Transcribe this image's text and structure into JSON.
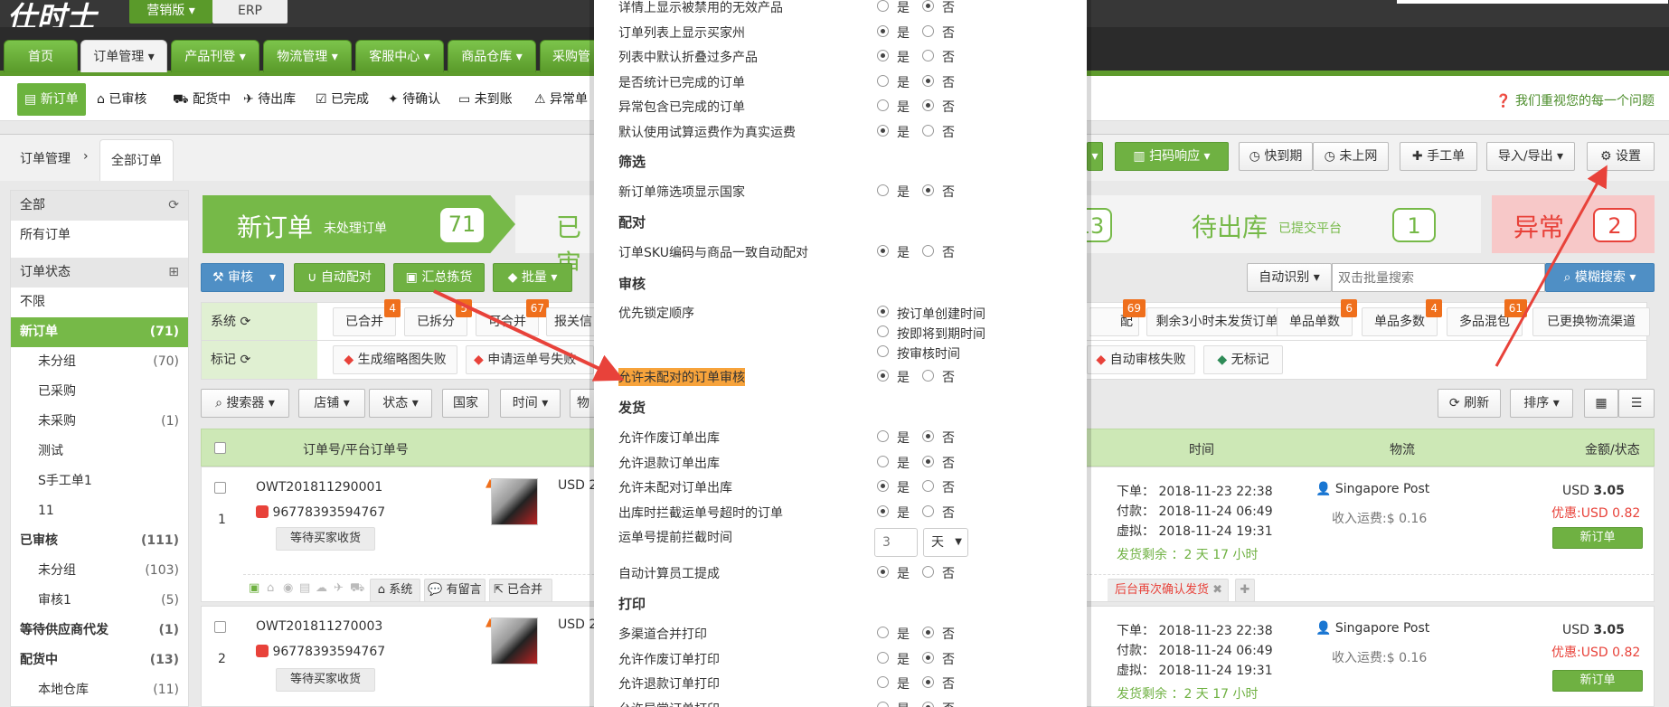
{
  "header": {
    "logo": "仕时士",
    "btn_sales": "营销版 ▾",
    "btn_erp": "ERP"
  },
  "nav": {
    "tabs": [
      "首页",
      "订单管理 ▾",
      "产品刊登 ▾",
      "物流管理 ▾",
      "客服中心 ▾",
      "商品仓库 ▾",
      "采购管"
    ]
  },
  "subnav": {
    "items": [
      "新订单",
      "已审核",
      "配货中",
      "待出库",
      "已完成",
      "待确认",
      "未到账",
      "异常单"
    ],
    "help": "我们重视您的每一个问题"
  },
  "breadcrumb": {
    "root": "订单管理",
    "sep": "›",
    "tab": "全部订单"
  },
  "sidebar": {
    "all": "全部",
    "all_orders": "所有订单",
    "status_header": "订单状态",
    "items": [
      {
        "label": "不限",
        "count": ""
      },
      {
        "label": "新订单",
        "count": "(71)"
      },
      {
        "label": "未分组",
        "count": "(70)"
      },
      {
        "label": "已采购",
        "count": ""
      },
      {
        "label": "未采购",
        "count": "(1)"
      },
      {
        "label": "测试",
        "count": ""
      },
      {
        "label": "S手工单1",
        "count": ""
      },
      {
        "label": "11",
        "count": ""
      },
      {
        "label": "已审核",
        "count": "(111)"
      },
      {
        "label": "未分组",
        "count": "(103)"
      },
      {
        "label": "审核1",
        "count": "(5)"
      },
      {
        "label": "等待供应商代发",
        "count": "(1)"
      },
      {
        "label": "配货中",
        "count": "(13)"
      },
      {
        "label": "本地仓库",
        "count": "(11)"
      }
    ]
  },
  "banner": {
    "new_title": "新订单",
    "new_sub": "未处理订单",
    "new_count": "71",
    "audited_partial": "已审",
    "partial_count": "13",
    "pending_title": "待出库",
    "pending_sub": "已提交平台",
    "pending_count": "1",
    "abnormal_title": "异常",
    "abnormal_count": "2"
  },
  "toolbar": {
    "audit": "审核",
    "auto_match": "自动配对",
    "summary": "汇总拣货",
    "batch": "批量",
    "scan": "扫码响应",
    "expiring": "快到期",
    "not_online": "未上网",
    "manual": "手工单",
    "import_export": "导入/导出 ▾",
    "settings": "设置",
    "auto_detect": "自动识别 ▾",
    "search_placeholder": "双击批量搜索",
    "fuzzy_search": "模糊搜索"
  },
  "system_row": {
    "label": "系统",
    "tags": [
      {
        "t": "已合并",
        "b": "4"
      },
      {
        "t": "已拆分",
        "b": "5"
      },
      {
        "t": "可合并",
        "b": "67"
      },
      {
        "t": "报关信",
        "b": ""
      },
      {
        "t": "配",
        "b": "69"
      },
      {
        "t": "剩余3小时未发货订单",
        "b": ""
      },
      {
        "t": "单品单数",
        "b": "6"
      },
      {
        "t": "单品多数",
        "b": "4"
      },
      {
        "t": "多品混包",
        "b": "61"
      },
      {
        "t": "已更换物流渠道",
        "b": ""
      }
    ]
  },
  "mark_row": {
    "label": "标记",
    "tags": [
      "生成缩略图失败",
      "申请运单号失败",
      "自动审核失败",
      "无标记"
    ]
  },
  "filters": [
    "搜索器 ▾",
    "店铺 ▾",
    "状态 ▾",
    "国家",
    "时间 ▾",
    "物"
  ],
  "right_tools": {
    "refresh": "刷新",
    "sort": "排序 ▾"
  },
  "table": {
    "headers": {
      "order": "订单号/平台订单号",
      "time": "时间",
      "logistics": "物流",
      "amount": "金额/状态"
    },
    "rows": [
      {
        "index": "1",
        "order_no": "OWT201811290001",
        "platform_no": "96778393594767",
        "status": "等待买家收货",
        "price_partial": "USD 2",
        "time_order": "下单：  2018-11-23 22:38",
        "time_pay": "付款：  2018-11-24 06:49",
        "time_virtual": "虚拟：  2018-11-24 19:31",
        "ship_left": "发货剩余 ：2 天 17 小时",
        "logistics": "Singapore Post",
        "shipping_income": "收入运费:$ 0.16",
        "amount_prefix": "USD ",
        "amount": "3.05",
        "discount": "优惠:USD 0.82",
        "state_btn": "新订单"
      },
      {
        "index": "2",
        "order_no": "OWT201811270003",
        "platform_no": "96778393594767",
        "status": "等待买家收货",
        "price_partial": "USD 2",
        "time_order": "下单：  2018-11-23 22:38",
        "time_pay": "付款：  2018-11-24 06:49",
        "time_virtual": "虚拟：  2018-11-24 19:31",
        "ship_left": "发货剩余 ：2 天 17 小时",
        "logistics": "Singapore Post",
        "shipping_income": "收入运费:$ 0.16",
        "amount_prefix": "USD ",
        "amount": "3.05",
        "discount": "优惠:USD 0.82",
        "state_btn": "新订单"
      }
    ],
    "row1_actions": {
      "system": "系统",
      "message": "有留言",
      "merged": "已合并",
      "confirm_ship": "后台再次确认发货"
    }
  },
  "modal": {
    "yes": "是",
    "no": "否",
    "items_top": [
      {
        "label": "详情上显示被禁用的无效产品",
        "value": "no"
      },
      {
        "label": "订单列表上显示买家州",
        "value": "yes"
      },
      {
        "label": "列表中默认折叠过多产品",
        "value": "yes"
      },
      {
        "label": "是否统计已完成的订单",
        "value": "no"
      },
      {
        "label": "异常包含已完成的订单",
        "value": "no"
      },
      {
        "label": "默认使用试算运费作为真实运费",
        "value": "yes"
      }
    ],
    "sec_filter": "筛选",
    "filter_item": "新订单筛选项显示国家",
    "sec_match": "配对",
    "match_item": "订单SKU编码与商品一致自动配对",
    "sec_audit": "审核",
    "audit_priority": "优先锁定顺序",
    "priority_opts": [
      "按订单创建时间",
      "按即将到期时间",
      "按审核时间"
    ],
    "audit_unmatched": "允许未配对的订单审核",
    "sec_ship": "发货",
    "ship_items": [
      {
        "label": "允许作废订单出库",
        "value": "no"
      },
      {
        "label": "允许退款订单出库",
        "value": "no"
      },
      {
        "label": "允许未配对订单出库",
        "value": "yes"
      },
      {
        "label": "出库时拦截运单号超时的订单",
        "value": "yes"
      }
    ],
    "intercept_time": "运单号提前拦截时间",
    "intercept_value": "3",
    "intercept_unit": "天",
    "auto_commission": "自动计算员工提成",
    "sec_print": "打印",
    "print_items": [
      {
        "label": "多渠道合并打印",
        "value": "no"
      },
      {
        "label": "允许作废订单打印",
        "value": "no"
      },
      {
        "label": "允许退款订单打印",
        "value": "no"
      },
      {
        "label": "允许异常订单打印",
        "value": "no"
      }
    ]
  },
  "colors": {
    "brand_green": "#6fb142",
    "accent_orange": "#f7a33b",
    "arrow_red": "#e8423a"
  }
}
